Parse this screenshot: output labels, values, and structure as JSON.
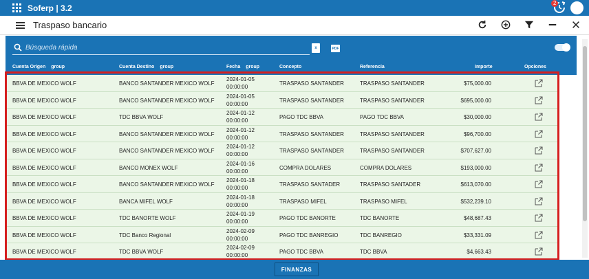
{
  "app": {
    "title": "Soferp | 3.2",
    "notification_count": "2"
  },
  "toolbar": {
    "page_title": "Traspaso bancario"
  },
  "search": {
    "placeholder": "Búsqueda rápida"
  },
  "table": {
    "columns": {
      "cuenta_origen": "Cuenta Origen",
      "cuenta_destino": "Cuenta Destino",
      "fecha": "Fecha",
      "concepto": "Concepto",
      "referencia": "Referencia",
      "importe": "Importe",
      "opciones": "Opciones",
      "group": "group"
    },
    "rows": [
      {
        "origen": "BBVA DE MEXICO WOLF",
        "destino": "BANCO SANTANDER MEXICO WOLF",
        "fecha_d": "2024-01-05",
        "fecha_t": "00:00:00",
        "concepto": "TRASPASO SANTANDER",
        "referencia": "TRASPASO SANTANDER",
        "importe": "$75,000.00"
      },
      {
        "origen": "BBVA DE MEXICO WOLF",
        "destino": "BANCO SANTANDER MEXICO WOLF",
        "fecha_d": "2024-01-05",
        "fecha_t": "00:00:00",
        "concepto": "TRASPASO SANTANDER",
        "referencia": "TRASPASO SANTANDER",
        "importe": "$695,000.00"
      },
      {
        "origen": "BBVA DE MEXICO WOLF",
        "destino": "TDC BBVA WOLF",
        "fecha_d": "2024-01-12",
        "fecha_t": "00:00:00",
        "concepto": "PAGO TDC BBVA",
        "referencia": "PAGO TDC BBVA",
        "importe": "$30,000.00"
      },
      {
        "origen": "BBVA DE MEXICO WOLF",
        "destino": "BANCO SANTANDER MEXICO WOLF",
        "fecha_d": "2024-01-12",
        "fecha_t": "00:00:00",
        "concepto": "TRASPASO SANTANDER",
        "referencia": "TRASPASO SANTANDER",
        "importe": "$96,700.00"
      },
      {
        "origen": "BBVA DE MEXICO WOLF",
        "destino": "BANCO SANTANDER MEXICO WOLF",
        "fecha_d": "2024-01-12",
        "fecha_t": "00:00:00",
        "concepto": "TRASPASO SANTANDER",
        "referencia": "TRASPASO SANTANDER",
        "importe": "$707,627.00"
      },
      {
        "origen": "BBVA DE MEXICO WOLF",
        "destino": "BANCO MONEX WOLF",
        "fecha_d": "2024-01-16",
        "fecha_t": "00:00:00",
        "concepto": "COMPRA DOLARES",
        "referencia": "COMPRA DOLARES",
        "importe": "$193,000.00"
      },
      {
        "origen": "BBVA DE MEXICO WOLF",
        "destino": "BANCO SANTANDER MEXICO WOLF",
        "fecha_d": "2024-01-18",
        "fecha_t": "00:00:00",
        "concepto": "TRASPASO SANTADER",
        "referencia": "TRASPASO SANTADER",
        "importe": "$613,070.00"
      },
      {
        "origen": "BBVA DE MEXICO WOLF",
        "destino": "BANCA MIFEL WOLF",
        "fecha_d": "2024-01-18",
        "fecha_t": "00:00:00",
        "concepto": "TRASPASO MIFEL",
        "referencia": "TRASPASO MIFEL",
        "importe": "$532,239.10"
      },
      {
        "origen": "BBVA DE MEXICO WOLF",
        "destino": "TDC BANORTE WOLF",
        "fecha_d": "2024-01-19",
        "fecha_t": "00:00:00",
        "concepto": "PAGO TDC BANORTE",
        "referencia": "TDC BANORTE",
        "importe": "$48,687.43"
      },
      {
        "origen": "BBVA DE MEXICO WOLF",
        "destino": "TDC Banco Regional",
        "fecha_d": "2024-02-09",
        "fecha_t": "00:00:00",
        "concepto": "PAGO TDC BANREGIO",
        "referencia": "TDC BANREGIO",
        "importe": "$33,331.09"
      },
      {
        "origen": "BBVA DE MEXICO WOLF",
        "destino": "TDC BBVA WOLF",
        "fecha_d": "2024-02-09",
        "fecha_t": "00:00:00",
        "concepto": "PAGO TDC BBVA",
        "referencia": "TDC BBVA",
        "importe": "$4,663.43"
      }
    ]
  },
  "footer": {
    "button_label": "FINANZAS"
  },
  "colors": {
    "primary": "#1a73b5",
    "row_bg": "#ebf6e7",
    "highlight": "#d61f1f"
  },
  "icons": [
    "apps-grid-icon",
    "notification-refresh-icon",
    "avatar",
    "menu-icon",
    "refresh-icon",
    "add-icon",
    "filter-icon",
    "minimize-icon",
    "close-icon",
    "search-icon",
    "excel-export-icon",
    "pdf-export-icon",
    "edit-icon"
  ]
}
